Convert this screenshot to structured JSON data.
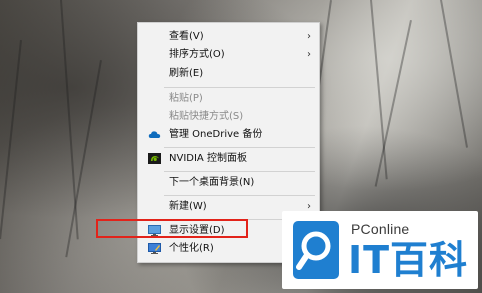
{
  "context_menu": {
    "items": [
      {
        "label": "查看(V)",
        "submenu": true,
        "disabled": false
      },
      {
        "label": "排序方式(O)",
        "submenu": true,
        "disabled": false
      },
      {
        "label": "刷新(E)",
        "submenu": false,
        "disabled": false
      },
      {
        "label": "粘贴(P)",
        "submenu": false,
        "disabled": true
      },
      {
        "label": "粘贴快捷方式(S)",
        "submenu": false,
        "disabled": true
      },
      {
        "label": "管理 OneDrive 备份",
        "submenu": false,
        "disabled": false,
        "icon": "cloud-icon"
      },
      {
        "label": "NVIDIA 控制面板",
        "submenu": false,
        "disabled": false,
        "icon": "nvidia-icon"
      },
      {
        "label": "下一个桌面背景(N)",
        "submenu": false,
        "disabled": false
      },
      {
        "label": "新建(W)",
        "submenu": true,
        "disabled": false
      },
      {
        "label": "显示设置(D)",
        "submenu": false,
        "disabled": false,
        "icon": "display-icon",
        "highlighted": true
      },
      {
        "label": "个性化(R)",
        "submenu": false,
        "disabled": false,
        "icon": "personalize-icon"
      }
    ],
    "submenu_arrow": "›"
  },
  "watermark": {
    "small_text": "PConline",
    "big_text": "IT百科",
    "brand_color": "#1f7fd0"
  },
  "colors": {
    "highlight_border": "#e2231a",
    "menu_bg": "#f2f2f2"
  }
}
